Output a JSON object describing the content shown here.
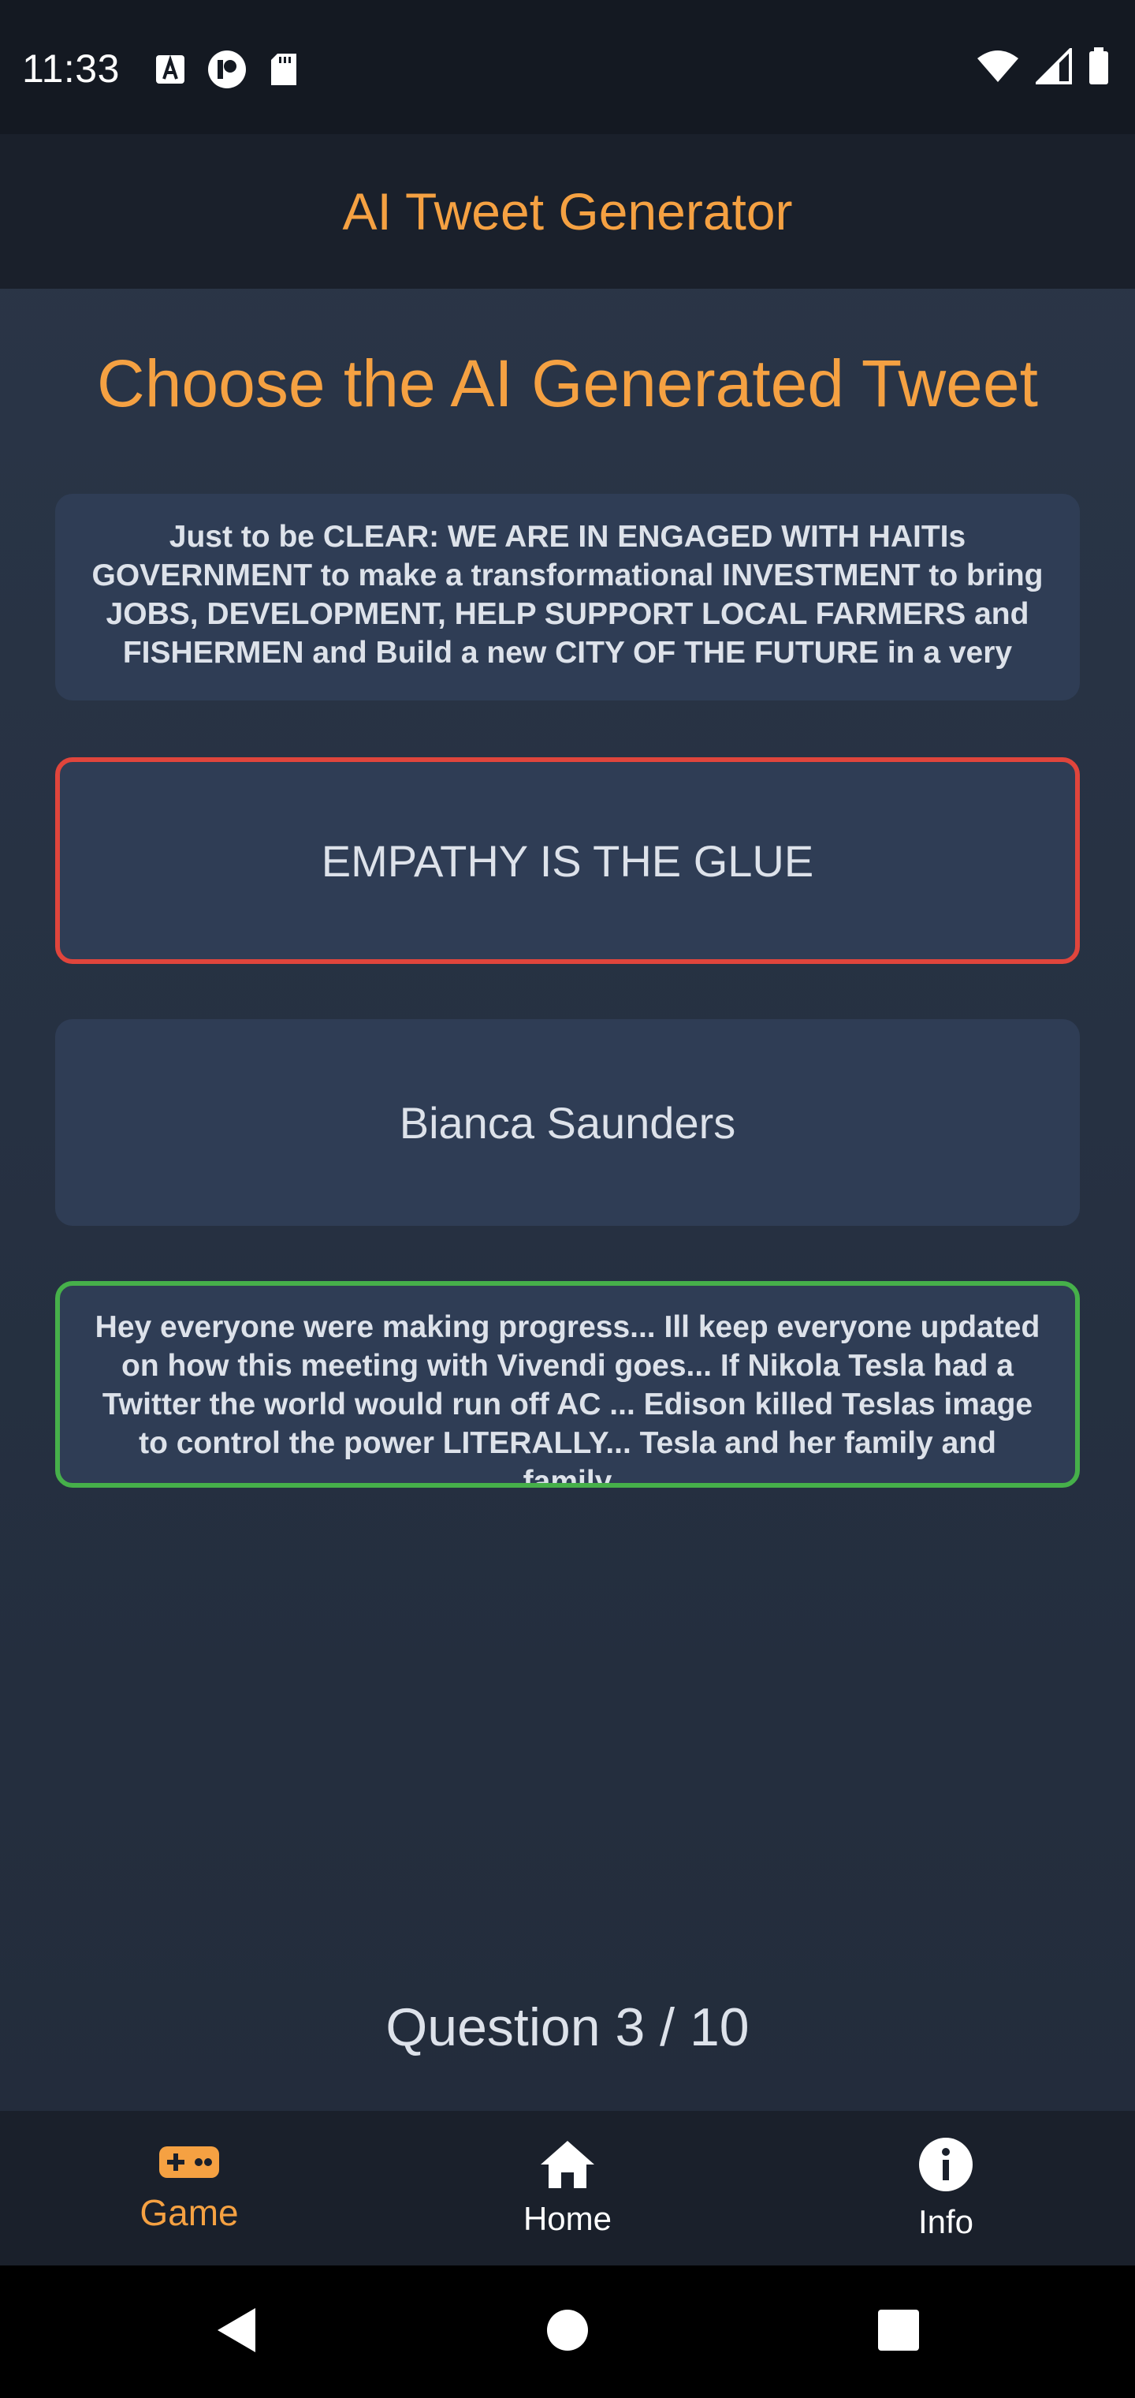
{
  "status_bar": {
    "time": "11:33",
    "left_icons": [
      "font-a-icon",
      "notification-p-icon",
      "sd-card-icon"
    ],
    "right_icons": [
      "wifi-icon",
      "signal-icon",
      "battery-icon"
    ]
  },
  "app_bar": {
    "title": "AI Tweet Generator"
  },
  "main": {
    "headline": "Choose the AI Generated Tweet",
    "options": [
      {
        "text": "Just to be CLEAR: WE ARE IN ENGAGED WITH HAITIs GOVERNMENT  to make a transformational INVESTMENT to bring  JOBS,  DEVELOPMENT, HELP SUPPORT LOCAL  FARMERS and FISHERMEN and Build a  new CITY OF THE FUTURE in a very",
        "state": "neutral"
      },
      {
        "text": "EMPATHY IS THE GLUE",
        "state": "incorrect"
      },
      {
        "text": "Bianca Saunders",
        "state": "neutral"
      },
      {
        "text": "Hey everyone were making progress... Ill keep everyone updated on how this meeting with Vivendi goes... If Nikola Tesla had a Twitter the world would run off AC ... Edison killed Teslas image to control the power LITERALLY... Tesla and her family and family",
        "state": "correct"
      }
    ],
    "question_counter": "Question 3 / 10"
  },
  "bottom_nav": {
    "items": [
      {
        "label": "Game",
        "icon": "gamepad-icon",
        "active": true
      },
      {
        "label": "Home",
        "icon": "home-icon",
        "active": false
      },
      {
        "label": "Info",
        "icon": "info-icon",
        "active": false
      }
    ]
  },
  "system_nav": {
    "buttons": [
      "back-icon",
      "home-circle-icon",
      "recents-square-icon"
    ]
  },
  "colors": {
    "accent": "#f5a142",
    "incorrect_border": "#e0453c",
    "correct_border": "#46b04a",
    "card_bg": "#2f3d55",
    "bar_bg": "#1a202b"
  }
}
